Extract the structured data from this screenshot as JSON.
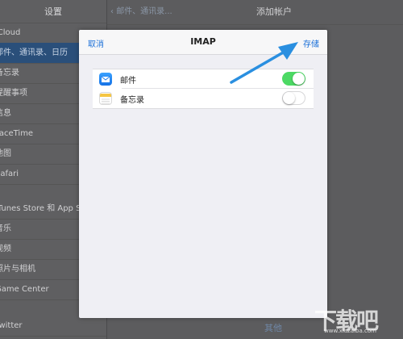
{
  "settings_sidebar": {
    "title": "设置",
    "items": [
      {
        "label": "iCloud"
      },
      {
        "label": "邮件、通讯录、日历"
      },
      {
        "label": "备忘录"
      },
      {
        "label": "提醒事项"
      },
      {
        "label": "信息"
      },
      {
        "label": "FaceTime"
      },
      {
        "label": "地图"
      },
      {
        "label": "Safari"
      },
      {
        "label": "iTunes Store 和 App Store"
      },
      {
        "label": "音乐"
      },
      {
        "label": "视频"
      },
      {
        "label": "照片与相机"
      },
      {
        "label": "Game Center"
      },
      {
        "label": "Twitter"
      }
    ]
  },
  "detail_pane": {
    "back_label": "邮件、通讯录...",
    "title": "添加帐户",
    "other_link": "其他"
  },
  "modal": {
    "cancel_label": "取消",
    "title": "IMAP",
    "save_label": "存储",
    "rows": [
      {
        "label": "邮件",
        "icon": "mail-icon",
        "enabled": true
      },
      {
        "label": "备忘录",
        "icon": "notes-icon",
        "enabled": false
      }
    ]
  },
  "watermark": {
    "text": "下载吧",
    "url": "www.xiazaiba.com"
  },
  "colors": {
    "accent": "#1a6fd8",
    "toggle_on": "#4cd964",
    "arrow": "#2a8fe0"
  }
}
